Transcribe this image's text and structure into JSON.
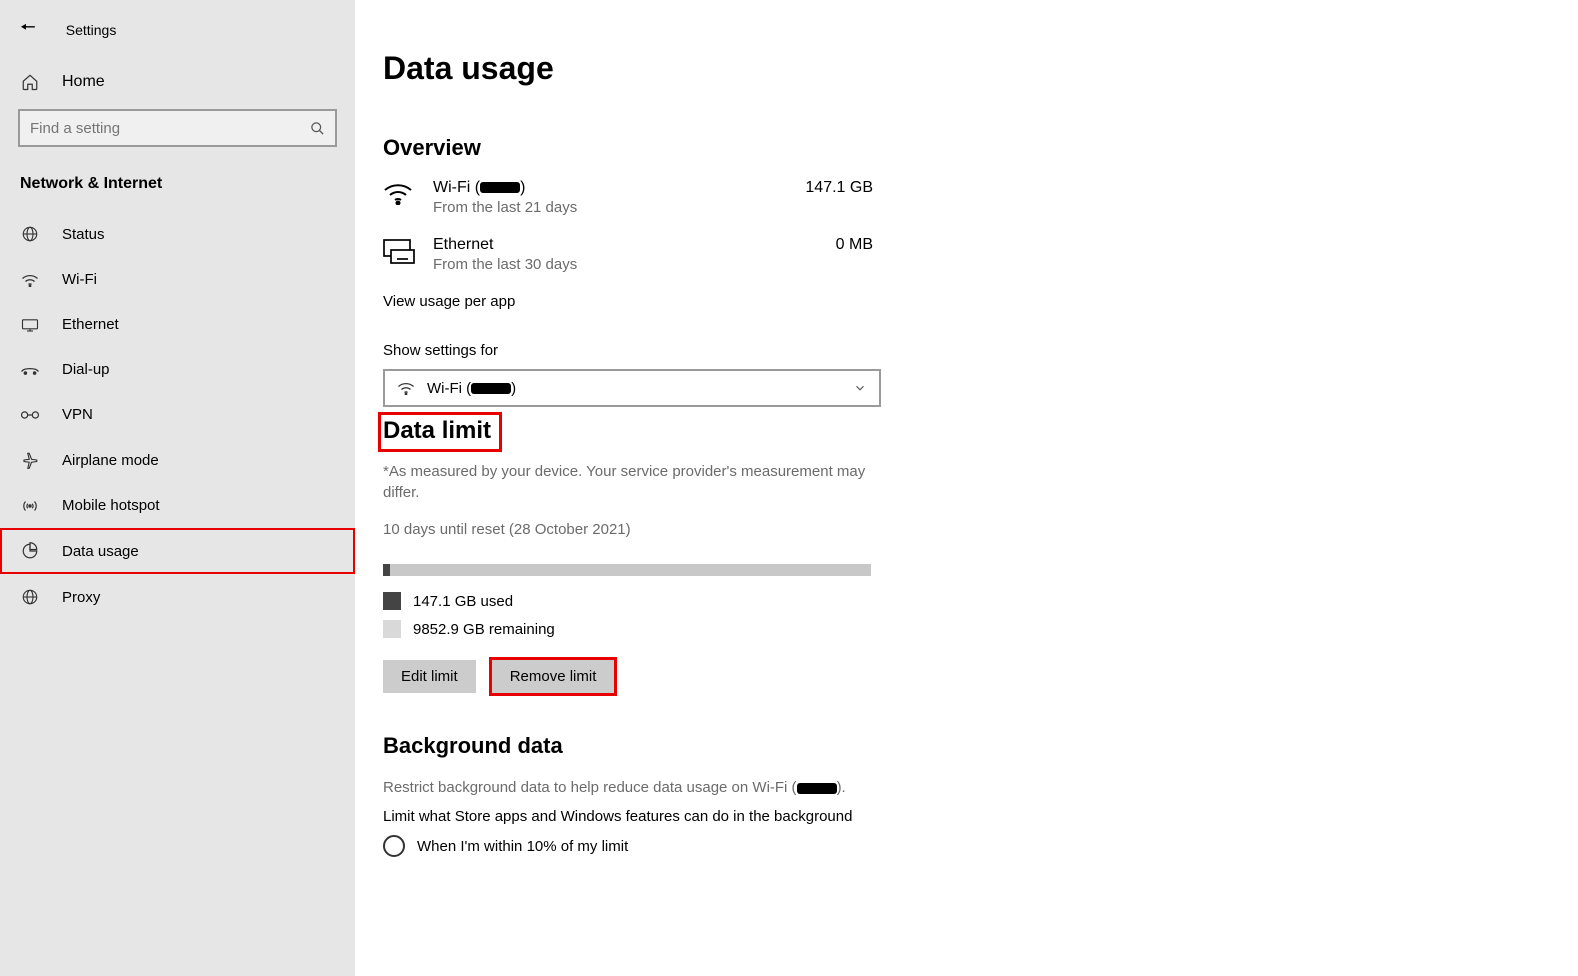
{
  "header": {
    "title": "Settings"
  },
  "sidebar": {
    "home": "Home",
    "search_placeholder": "Find a setting",
    "section": "Network & Internet",
    "items": [
      {
        "label": "Status"
      },
      {
        "label": "Wi-Fi"
      },
      {
        "label": "Ethernet"
      },
      {
        "label": "Dial-up"
      },
      {
        "label": "VPN"
      },
      {
        "label": "Airplane mode"
      },
      {
        "label": "Mobile hotspot"
      },
      {
        "label": "Data usage"
      },
      {
        "label": "Proxy"
      }
    ]
  },
  "page": {
    "title": "Data usage",
    "overview": {
      "heading": "Overview",
      "wifi": {
        "name_prefix": "Wi-Fi (",
        "name_suffix": ")",
        "sub": "From the last 21 days",
        "value": "147.1 GB"
      },
      "ethernet": {
        "name": "Ethernet",
        "sub": "From the last 30 days",
        "value": "0 MB"
      },
      "link": "View usage per app"
    },
    "show_settings": {
      "label": "Show settings for",
      "value_prefix": "Wi-Fi (",
      "value_suffix": ")"
    },
    "data_limit": {
      "heading": "Data limit",
      "note": "*As measured by your device. Your service provider's measurement may differ.",
      "reset": "10 days until reset (28 October 2021)",
      "used": "147.1 GB used",
      "remaining": "9852.9 GB remaining",
      "edit_btn": "Edit limit",
      "remove_btn": "Remove limit"
    },
    "background": {
      "heading": "Background data",
      "sub_prefix": "Restrict background data to help reduce data usage on Wi-Fi (",
      "sub_suffix": ").",
      "line2": "Limit what Store apps and Windows features can do in the background",
      "radio1": "When I'm within 10% of my limit"
    }
  }
}
